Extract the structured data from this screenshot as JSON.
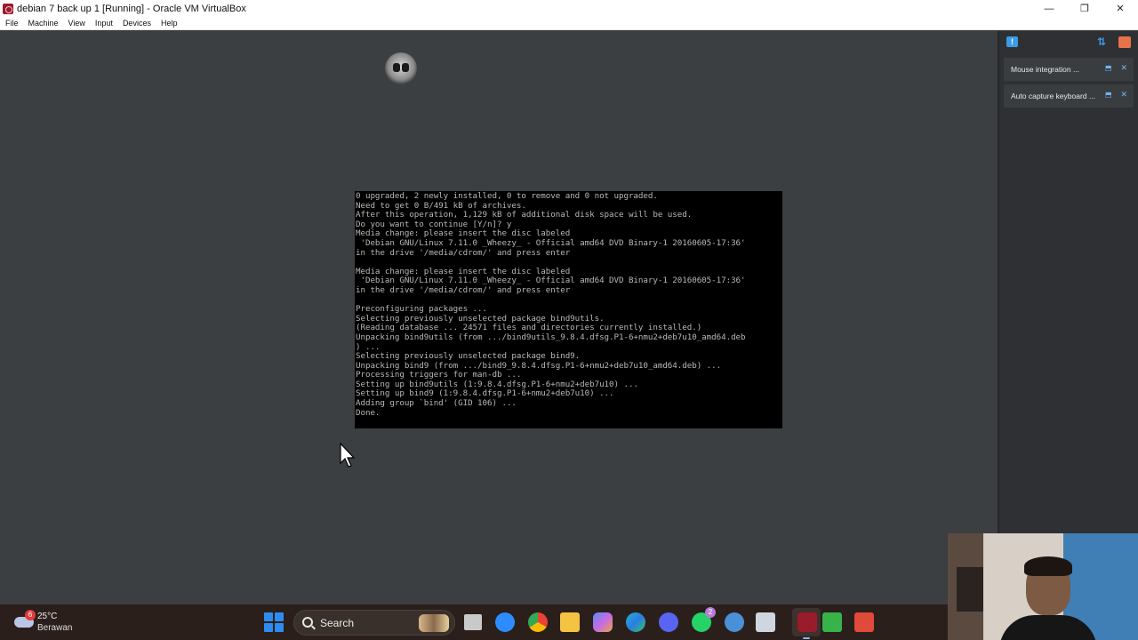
{
  "window": {
    "title": "debian 7 back up 1 [Running] - Oracle VM VirtualBox",
    "controls": {
      "minimize": "—",
      "restore": "❐",
      "close": "✕"
    }
  },
  "menubar": {
    "items": [
      "File",
      "Machine",
      "View",
      "Input",
      "Devices",
      "Help"
    ]
  },
  "console": {
    "lines": [
      "0 upgraded, 2 newly installed, 0 to remove and 0 not upgraded.",
      "Need to get 0 B/491 kB of archives.",
      "After this operation, 1,129 kB of additional disk space will be used.",
      "Do you want to continue [Y/n]? y",
      "Media change: please insert the disc labeled",
      " 'Debian GNU/Linux 7.11.0 _Wheezy_ - Official amd64 DVD Binary-1 20160605-17:36'",
      "in the drive '/media/cdrom/' and press enter",
      "",
      "Media change: please insert the disc labeled",
      " 'Debian GNU/Linux 7.11.0 _Wheezy_ - Official amd64 DVD Binary-1 20160605-17:36'",
      "in the drive '/media/cdrom/' and press enter",
      "",
      "Preconfiguring packages ...",
      "Selecting previously unselected package bind9utils.",
      "(Reading database ... 24571 files and directories currently installed.)",
      "Unpacking bind9utils (from .../bind9utils_9.8.4.dfsg.P1-6+nmu2+deb7u10_amd64.deb",
      ") ...",
      "Selecting previously unselected package bind9.",
      "Unpacking bind9 (from .../bind9_9.8.4.dfsg.P1-6+nmu2+deb7u10_amd64.deb) ...",
      "Processing triggers for man-db ...",
      "Setting up bind9utils (1:9.8.4.dfsg.P1-6+nmu2+deb7u10) ...",
      "Setting up bind9 (1:9.8.4.dfsg.P1-6+nmu2+deb7u10) ...",
      "Adding group `bind' (GID 106) ...",
      "Done."
    ]
  },
  "side_panel": {
    "notifications": [
      {
        "text": "Mouse integration ..."
      },
      {
        "text": "Auto capture keyboard ..."
      }
    ],
    "close_glyph": "✕",
    "pin_glyph": "⬒"
  },
  "taskbar": {
    "weather": {
      "temp": "25°C",
      "desc": "Berawan",
      "badge": "6"
    },
    "search_label": "Search",
    "whatsapp_badge": "2",
    "colors": {
      "accent": "#2e8cf0",
      "taskbar_bg": "#2a1f1b"
    }
  }
}
